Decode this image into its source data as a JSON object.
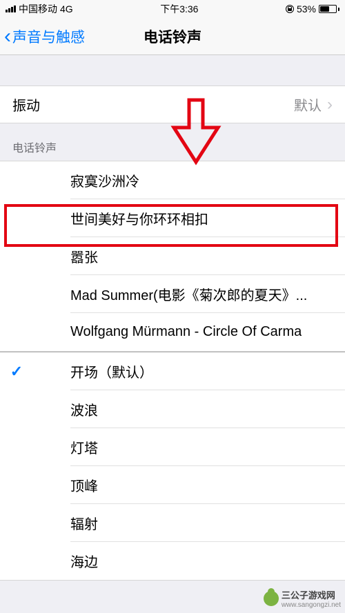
{
  "status_bar": {
    "carrier": "中国移动",
    "network": "4G",
    "time": "下午3:36",
    "battery_percent": "53%"
  },
  "nav": {
    "back_label": "声音与触感",
    "title": "电话铃声"
  },
  "vibration": {
    "label": "振动",
    "value": "默认"
  },
  "section_header": "电话铃声",
  "custom_ringtones": [
    {
      "label": "寂寞沙洲冷",
      "checked": false
    },
    {
      "label": "世间美好与你环环相扣",
      "checked": false
    },
    {
      "label": "嚣张",
      "checked": false
    },
    {
      "label": "Mad Summer(电影《菊次郎的夏天》...",
      "checked": false
    },
    {
      "label": "Wolfgang Mürmann - Circle Of Carma",
      "checked": false
    }
  ],
  "system_ringtones": [
    {
      "label": "开场（默认）",
      "checked": true
    },
    {
      "label": "波浪",
      "checked": false
    },
    {
      "label": "灯塔",
      "checked": false
    },
    {
      "label": "顶峰",
      "checked": false
    },
    {
      "label": "辐射",
      "checked": false
    },
    {
      "label": "海边",
      "checked": false
    }
  ],
  "watermark": {
    "text": "三公子游戏网",
    "url": "www.sangongzi.net"
  },
  "annotation": {
    "highlight_index": 1,
    "color": "#e30613"
  }
}
